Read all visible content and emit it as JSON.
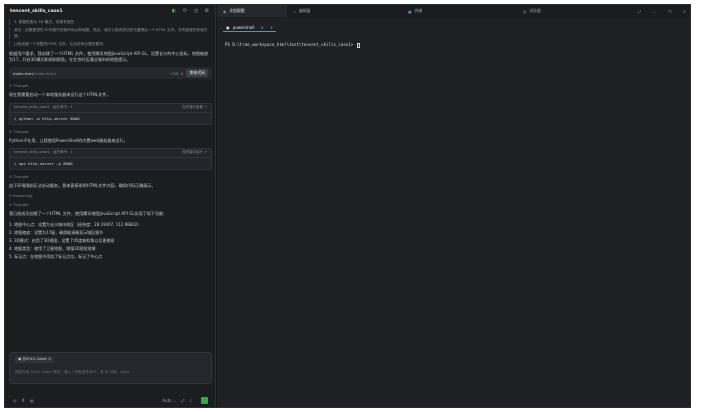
{
  "left_panel": {
    "title": "tencent_skills_case1",
    "header_icons": [
      "sync-icon",
      "refresh-icon",
      "history-icon",
      "settings-icon"
    ],
    "notes": [
      "3. 数据检索为 3D 模式，效果有强烈",
      "其次，如果要想在3D中展开的城市地点和地图，然后，我们以更改成功的位置确认一个HTML 文件，并有能够的布局方便。",
      "让我创建一个完整的HTML 文件，包含所有必要的要求。"
    ],
    "intro": "根据用户要求，我创建了一个HTML 文件，使用腾讯地图JavaScript API GL，设置长沙的中心坐标，地图缩放为17，开启3D模式和倾斜视角。在北京时区通过城市的地图提示。",
    "file_card": {
      "name": "index.html",
      "path": "index.html",
      "added": "+55",
      "removed": "-0",
      "button": "审核代码"
    },
    "thought1": "Thought",
    "text1": "现在我需要启动一个本地服务器来运行这个HTML文件。",
    "term1": {
      "title": "tencent_skills_case1 · 运行命令：1",
      "right": "在终端中查看 ↗",
      "cmd": "python -m http.server 8000"
    },
    "thought2": "Thought",
    "text2": "Python不在用，让我使用PowerShell的内置web服务器来运行。",
    "term2": {
      "title": "tencent_skills_case1 · 运行命令：1",
      "right": "在终端中运行 ↗",
      "cmd": "npx http-server -p 8000"
    },
    "thought3": "Thought",
    "text3": "由于环境限制无法启动服务，我来直接说明HTML文件内容，确保代码正确展示。",
    "thought4": "Reasoning",
    "thought5": "Thought",
    "summary": "我已经成功创建了一个HTML 文件，使用腾讯地图JavaScript API GL实现了如下功能：",
    "list": [
      "1. 地图中心点：设置为长沙城市地区（经纬度：28.19407, 112.98842）",
      "2. 地图缩放：设置为17级，确保能清晰显示城区细节",
      "3. 3D模式：启用了3D视图，设置了45度俯仰角以及更美观",
      "4. 地图类型：使用了卫星地图，增强3D视觉效果",
      "5. 标记点：在地图中添加了标记点位，标记了中心点"
    ],
    "chip": "@SOLO Coder",
    "placeholder": "按回车向 SOLO Coder 提问，输入 / 获取更多命令，或 @ 引用，/spec",
    "footer_mode": "Auto"
  },
  "top_tabs": [
    "文档视图",
    "编辑器",
    "终端",
    "浏览器"
  ],
  "terminal": {
    "tab_label": "powershell",
    "prompt": "PS D:\\trae_workspace_html\\test\\tencent_skills_case1> "
  },
  "colors": {
    "accent": "#4f8fe0",
    "success": "#53c26b",
    "danger": "#e06060"
  }
}
